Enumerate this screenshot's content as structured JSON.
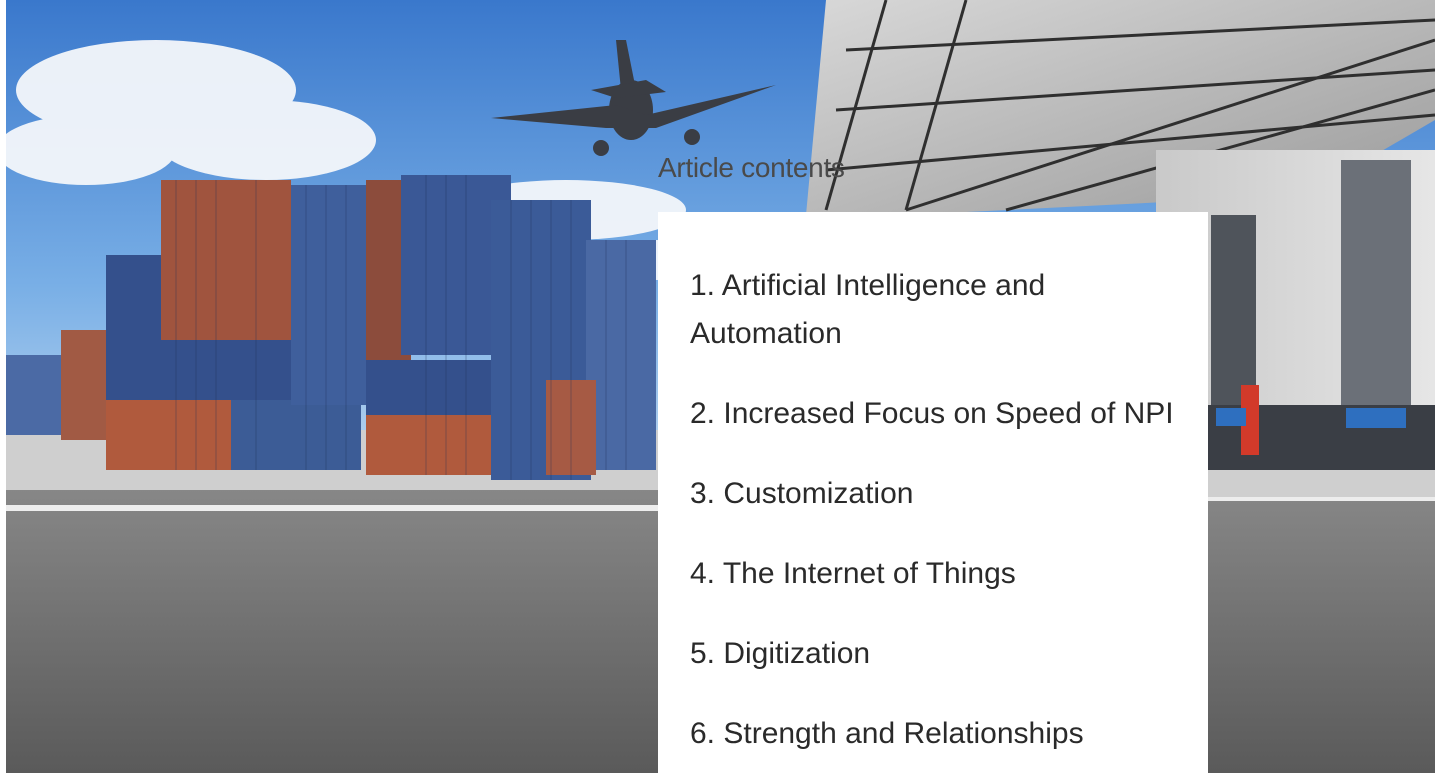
{
  "hero": {
    "image_subject": "cargo containers and airplane at logistics warehouse"
  },
  "toc": {
    "heading": "Article contents",
    "items": [
      {
        "label": "1. Artificial Intelligence and Automation"
      },
      {
        "label": "2. Increased Focus on Speed of NPI"
      },
      {
        "label": "3. Customization"
      },
      {
        "label": "4. The Internet of Things"
      },
      {
        "label": "5. Digitization"
      },
      {
        "label": "6. Strength and Relationships"
      }
    ]
  },
  "colors": {
    "sky_top": "#3f7fd0",
    "sky_bottom": "#a9cdee",
    "container_blue": "#34508c",
    "container_rust": "#a0543e",
    "asphalt": "#6e6e6e",
    "panel_bg": "#ffffff",
    "heading_text": "#4a4a4a",
    "item_text": "#2a2a2a"
  }
}
